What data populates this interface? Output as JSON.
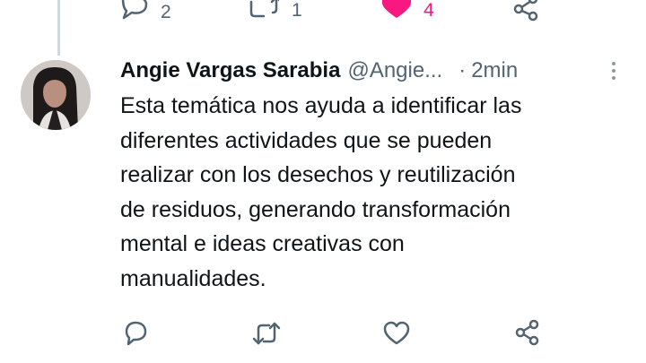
{
  "top_actions": {
    "reply_count": "2",
    "retweet_count": "1",
    "like_count": "4",
    "liked": true
  },
  "tweet": {
    "author_name": "Angie Vargas Sarabia",
    "handle": "@Angie...",
    "separator": "·",
    "time": "2min",
    "text": "Esta temática nos ayuda a identificar las\ndiferentes actividades que se pueden\nrealizar con  los desechos y  reutilización\nde residuos, generando transformación\nmental  e ideas creativas con\nmanualidades."
  },
  "icons": {
    "reply": "reply-icon",
    "retweet": "retweet-icon",
    "like": "heart-icon",
    "share": "share-icon",
    "more": "more-vertical-icon"
  },
  "colors": {
    "text": "#0f1419",
    "secondary": "#536471",
    "like": "#f91880",
    "thread_line": "#cfd9de"
  }
}
